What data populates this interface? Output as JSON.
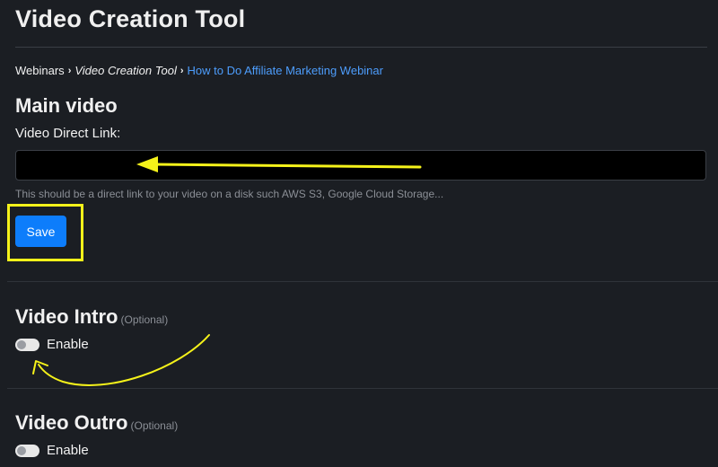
{
  "header": {
    "title": "Video Creation Tool"
  },
  "breadcrumb": {
    "items": [
      "Webinars",
      "Video Creation Tool",
      "How to Do Affiliate Marketing Webinar"
    ],
    "separator": "›"
  },
  "main_video": {
    "title": "Main video",
    "field_label": "Video Direct Link:",
    "input_value": "",
    "help_text": "This should be a direct link to your video on a disk such AWS S3, Google Cloud Storage...",
    "save_label": "Save"
  },
  "video_intro": {
    "title": "Video Intro",
    "optional_label": "(Optional)",
    "toggle_label": "Enable",
    "enabled": false
  },
  "video_outro": {
    "title": "Video Outro",
    "optional_label": "(Optional)",
    "toggle_label": "Enable",
    "enabled": false
  },
  "colors": {
    "background": "#1b1e23",
    "accent": "#0d7dfb",
    "link": "#4d9dfc",
    "annotation": "#f5f21a"
  }
}
